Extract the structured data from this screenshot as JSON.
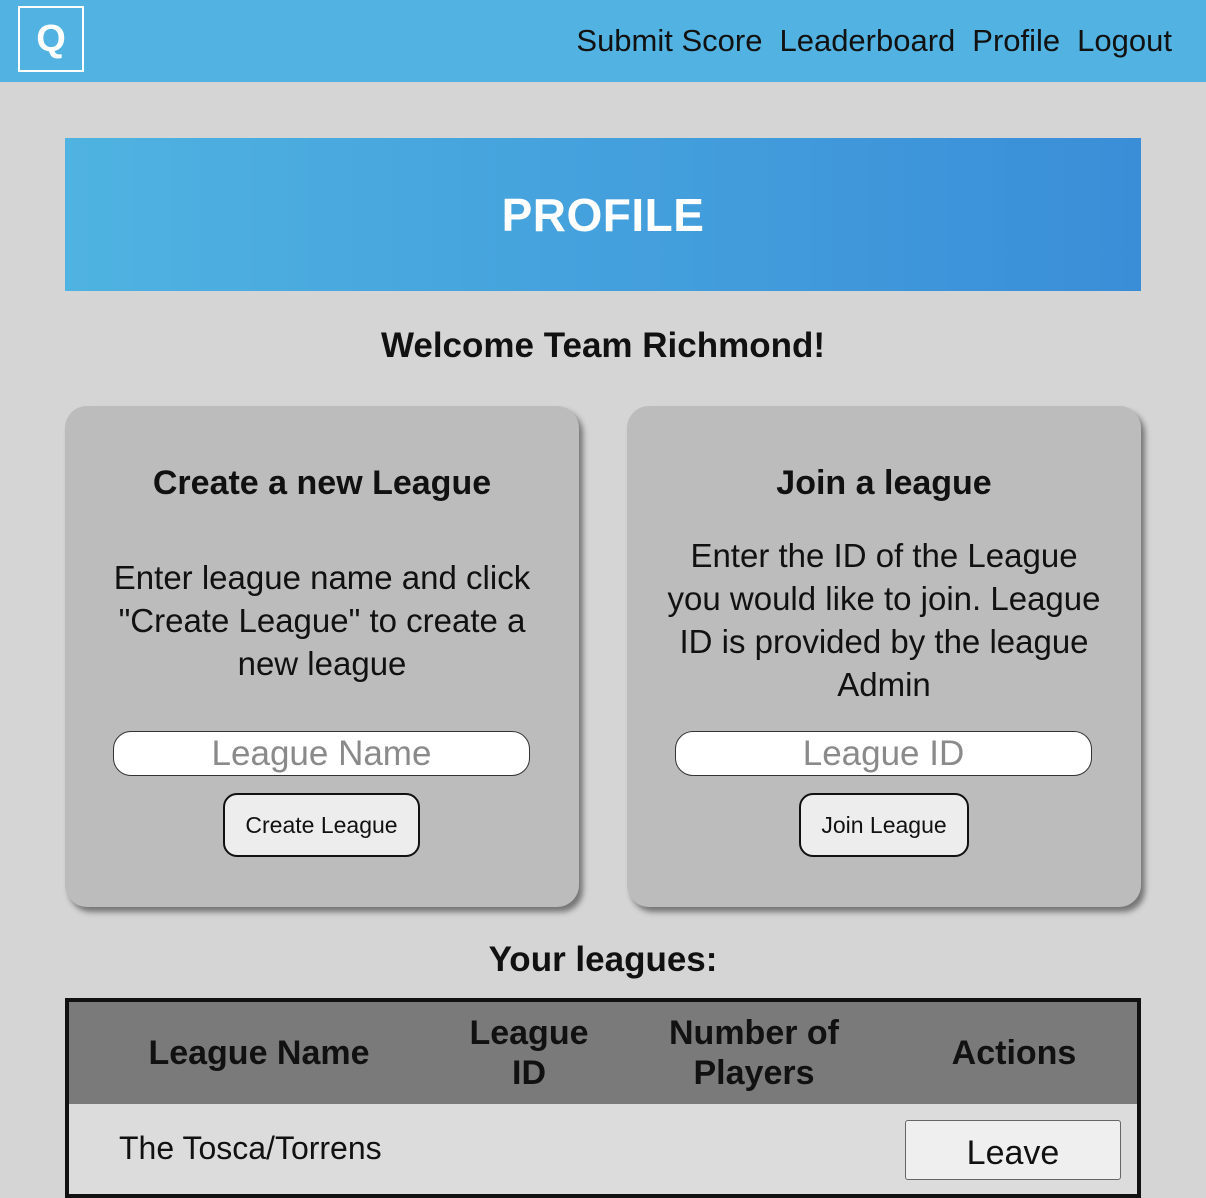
{
  "header": {
    "logo_letter": "Q",
    "nav": [
      "Submit Score",
      "Leaderboard",
      "Profile",
      "Logout"
    ]
  },
  "banner": {
    "title": "PROFILE"
  },
  "welcome": "Welcome Team Richmond!",
  "create_card": {
    "title": "Create a new League",
    "description": "Enter league name and click \"Create League\" to create a new league",
    "input_placeholder": "League Name",
    "input_value": "",
    "button_label": "Create League"
  },
  "join_card": {
    "title": "Join a league",
    "description": "Enter the ID of the League you would like to join. League ID is provided by the league Admin",
    "input_placeholder": "League ID",
    "input_value": "",
    "button_label": "Join League"
  },
  "leagues": {
    "title": "Your leagues:",
    "columns": [
      "League Name",
      "League ID",
      "Number of Players",
      "Actions"
    ],
    "rows": [
      {
        "name": "The Tosca/Torrens",
        "id": "",
        "players": "",
        "action": "Leave"
      }
    ]
  },
  "colors": {
    "topbar": "#52b3e2",
    "banner_start": "#4fb3e1",
    "banner_end": "#3a8ed8",
    "page_bg": "#d5d5d5",
    "card_bg": "#bdbcbd",
    "table_header_bg": "#7b7a7b"
  }
}
